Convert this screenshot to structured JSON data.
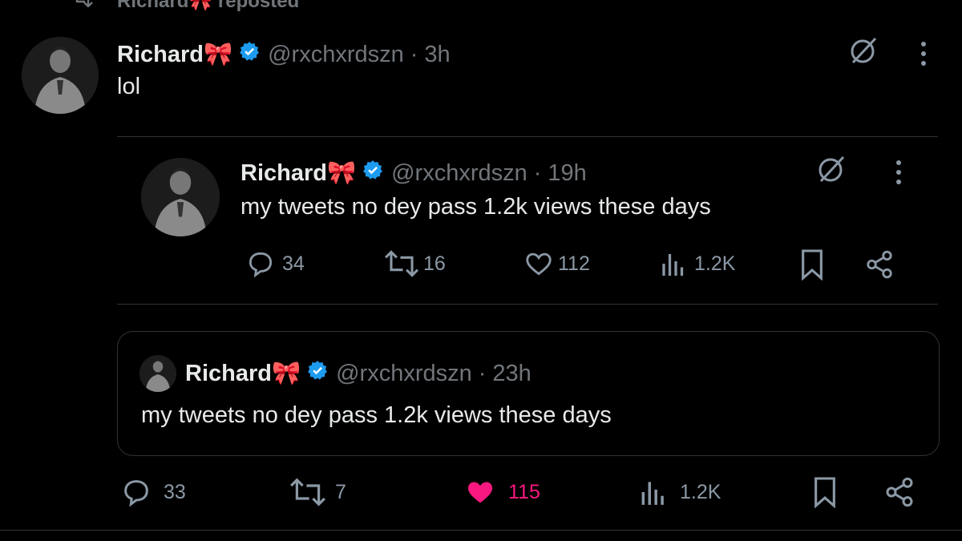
{
  "repost_banner": {
    "text": "Richard🎀 reposted"
  },
  "main_tweet": {
    "name": "Richard🎀",
    "handle": "@rxchxrdszn",
    "separator": "·",
    "time": "3h",
    "text": "lol",
    "actions": {
      "replies": "33",
      "reposts": "7",
      "likes": "115",
      "views": "1.2K"
    }
  },
  "embedded_tweet": {
    "name": "Richard🎀",
    "handle": "@rxchxrdszn",
    "separator": "·",
    "time": "19h",
    "text": "my tweets no dey pass 1.2k views these days",
    "actions": {
      "replies": "34",
      "reposts": "16",
      "likes": "112",
      "views": "1.2K"
    }
  },
  "quoted_tweet": {
    "name": "Richard🎀",
    "handle": "@rxchxrdszn",
    "separator": "·",
    "time": "23h",
    "text": "my tweets no dey pass 1.2k views these days"
  },
  "colors": {
    "accent_like": "#f91880",
    "verified": "#1d9bf0",
    "muted": "#71767b",
    "background": "#000000"
  },
  "icons": [
    "repost-icon",
    "grok-icon",
    "more-icon",
    "verified-icon",
    "reply-icon",
    "like-icon",
    "views-icon",
    "bookmark-icon",
    "share-icon"
  ]
}
